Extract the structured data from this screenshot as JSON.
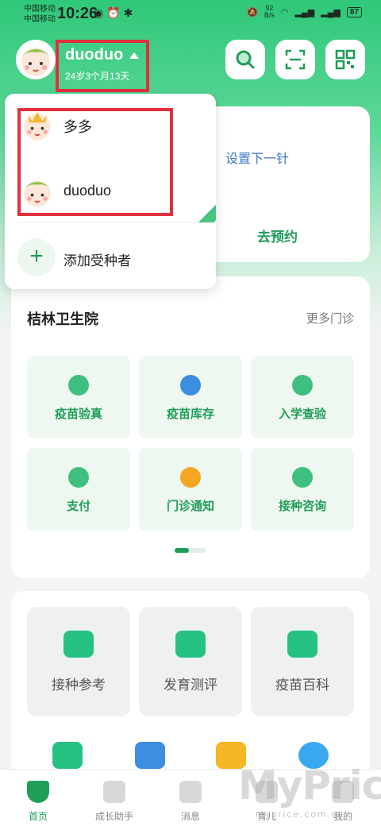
{
  "status_bar": {
    "carrier1": "中国移动",
    "carrier2": "中国移动",
    "time": "10:26",
    "speed": "92",
    "speed_unit": "B/s",
    "battery": "87"
  },
  "profile": {
    "name": "duoduo",
    "age": "24岁3个月13天"
  },
  "dropdown": {
    "items": [
      {
        "name": "多多"
      },
      {
        "name": "duoduo"
      }
    ],
    "add_label": "添加受种者"
  },
  "appointment": {
    "next": "设置下一针",
    "button": "去预约"
  },
  "hospital": {
    "name": "桔林卫生院",
    "more": "更多门诊",
    "tiles": [
      {
        "label": "疫苗验真",
        "color": "#3fbf7f"
      },
      {
        "label": "疫苗库存",
        "color": "#3b8ee0"
      },
      {
        "label": "入学查验",
        "color": "#3fbf7f"
      },
      {
        "label": "支付",
        "color": "#3fbf7f"
      },
      {
        "label": "门诊通知",
        "color": "#f5a623"
      },
      {
        "label": "接种咨询",
        "color": "#3fbf7f"
      }
    ]
  },
  "tools": {
    "items": [
      {
        "label": "接种参考"
      },
      {
        "label": "发育测评"
      },
      {
        "label": "疫苗百科"
      }
    ]
  },
  "tab_bar": {
    "tabs": [
      {
        "label": "首页"
      },
      {
        "label": "成长助手"
      },
      {
        "label": "消息"
      },
      {
        "label": "育儿"
      },
      {
        "label": "我的"
      }
    ]
  },
  "watermark": {
    "text": "MyPrice",
    "sub": "myprice.com.cn"
  }
}
